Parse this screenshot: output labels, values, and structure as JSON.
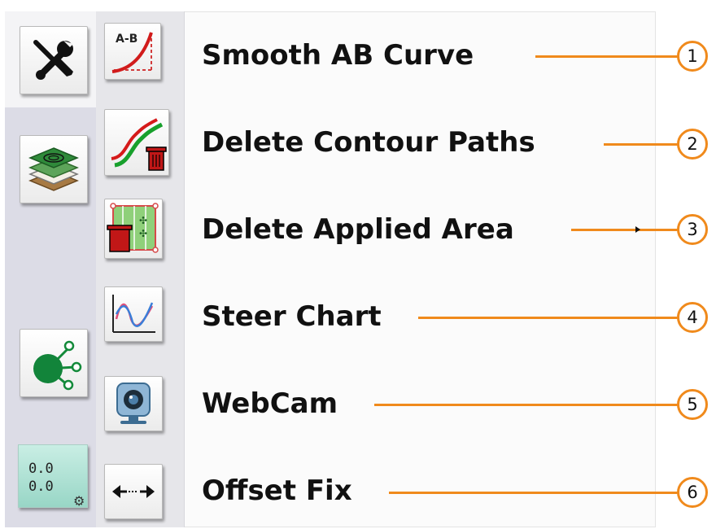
{
  "left_column": {
    "settings_icon": "wrench-screwdriver-icon",
    "layers_icon": "layers-map-icon",
    "node_icon": "node-network-icon",
    "coordinates": {
      "line1": "0.0",
      "line2": "0.0"
    },
    "coord_settings_icon": "gear-icon"
  },
  "menu_items": [
    {
      "label": "Smooth AB Curve",
      "number": "1",
      "icon": "ab-curve-icon"
    },
    {
      "label": "Delete Contour Paths",
      "number": "2",
      "icon": "delete-contour-icon"
    },
    {
      "label": "Delete Applied Area",
      "number": "3",
      "icon": "delete-area-icon"
    },
    {
      "label": "Steer Chart",
      "number": "4",
      "icon": "steer-chart-icon"
    },
    {
      "label": "WebCam",
      "number": "5",
      "icon": "webcam-icon"
    },
    {
      "label": "Offset Fix",
      "number": "6",
      "icon": "offset-fix-icon"
    }
  ],
  "ab_icon_text": "A-B",
  "colors": {
    "accent": "#f08a1c",
    "left_panel": "#dcdce6",
    "coords_button": "#a8ddd0"
  }
}
